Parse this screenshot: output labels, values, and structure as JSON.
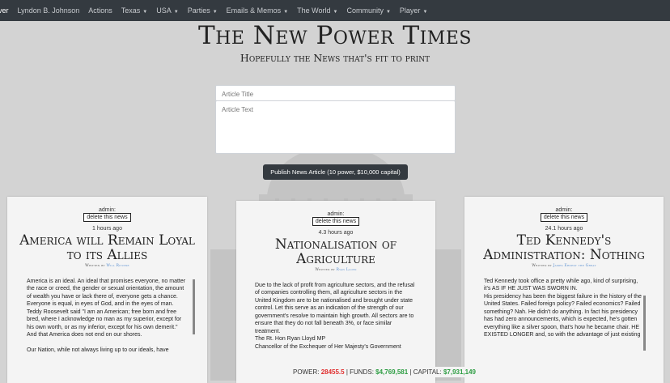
{
  "nav": {
    "brand": "ver",
    "items": [
      {
        "label": "Lyndon B. Johnson",
        "caret": false
      },
      {
        "label": "Actions",
        "caret": false
      },
      {
        "label": "Texas",
        "caret": true
      },
      {
        "label": "USA",
        "caret": true
      },
      {
        "label": "Parties",
        "caret": true
      },
      {
        "label": "Emails & Memos",
        "caret": true
      },
      {
        "label": "The World",
        "caret": true
      },
      {
        "label": "Community",
        "caret": true
      },
      {
        "label": "Player",
        "caret": true
      }
    ],
    "caret_icon": "caret-down-icon"
  },
  "masthead": {
    "title": "The New Power Times",
    "subtitle": "Hopefully the News that's fit to print"
  },
  "form": {
    "title_placeholder": "Article Title",
    "text_placeholder": "Article Text",
    "publish_label": "Publish News Article (10 power, $10,000 capital)"
  },
  "articles": [
    {
      "admin_label": "admin:",
      "delete_label": "delete this news",
      "time": "1 hours ago",
      "headline": "America will Remain Loyal to its Allies",
      "written_by": "Written by",
      "author": "Will Ritchie",
      "body": "America is an ideal. An ideal that promises everyone, no matter the race or creed, the gender or sexual orientation, the amount of wealth you have or lack there of, everyone gets a chance. Everyone is equal, in eyes of God, and in the eyes of man. Teddy Roosevelt said \"I am an American; free born and free bred, where I acknowledge no man as my superior, except for his own worth, or as my inferior, except for his own demerit.\" And that America does not end on our shores.\n\nOur Nation, while not always living up to our ideals, have"
    },
    {
      "admin_label": "admin:",
      "delete_label": "delete this news",
      "time": "4.3 hours ago",
      "headline": "Nationalisation of Agriculture",
      "written_by": "Written by",
      "author": "Ryan Lloyd",
      "body": "Due to the lack of profit from agriculture sectors, and the refusal of companies controlling them, all agriculture sectors in the United Kingdom are to be nationalised and brought under state control. Let this serve as an indication of the strength of our government's resolve to maintain high growth. All sectors are to ensure that they do not fall beneath 3%, or face similar treatment.\nThe Rt. Hon Ryan Lloyd MP\nChancellor of the Exchequer of Her Majesty's Government"
    },
    {
      "admin_label": "admin:",
      "delete_label": "delete this news",
      "time": "24.1 hours ago",
      "headline": "Ted Kennedy's Administration: Nothing",
      "written_by": "Written by",
      "author": "James Ernest the Great",
      "body": "Ted Kennedy took office a pretty while ago, kind of surprising, it's AS IF HE JUST WAS SWORN IN.\nHis presidency has been the biggest failure in the history of the United States. Failed foreign policy? Failed economics? Failed something? Nah. He didn't do anything. In fact his presidency has had zero announcements, which is expected, he's gotten everything like a silver spoon, that's how he became chair. HE EXISTED LONGER and, so with the advantage of just existing"
    }
  ],
  "status": {
    "power_label": "POWER:",
    "power_value": "28455.5",
    "funds_label": "| FUNDS:",
    "funds_value": "$4,769,581",
    "capital_label": "| CAPITAL:",
    "capital_value": "$7,931,149"
  },
  "colors": {
    "navbar": "#343a40",
    "background": "#d3d3d3",
    "power": "#e03131",
    "money": "#2f9e44",
    "author": "#5a8fd0"
  }
}
